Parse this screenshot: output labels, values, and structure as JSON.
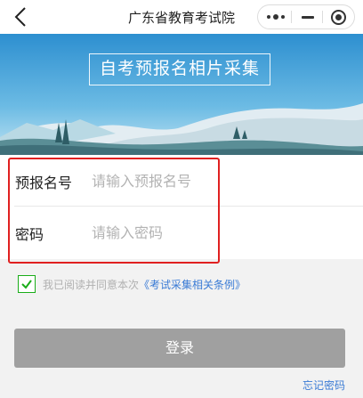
{
  "navbar": {
    "title": "广东省教育考试院",
    "back_icon": "chevron-left-icon",
    "more_icon": "more-dots-icon",
    "minimize_icon": "minus-icon",
    "close_icon": "target-circle-icon"
  },
  "banner": {
    "title": "自考预报名相片采集"
  },
  "form": {
    "fields": [
      {
        "label": "预报名号",
        "placeholder": "请输入预报名号",
        "value": ""
      },
      {
        "label": "密码",
        "placeholder": "请输入密码",
        "value": ""
      }
    ]
  },
  "agreement": {
    "checked": true,
    "text": "我已阅读并同意本次",
    "link": "《考试采集相关条例》"
  },
  "actions": {
    "login_label": "登录",
    "forgot_label": "忘记密码"
  },
  "colors": {
    "sky_top": "#2d8fd0",
    "sky_bottom": "#a8d8ef",
    "checkbox": "#1aad19",
    "link": "#3a7bd5",
    "login_button": "#a0a0a0",
    "highlight_box": "#e02020"
  }
}
